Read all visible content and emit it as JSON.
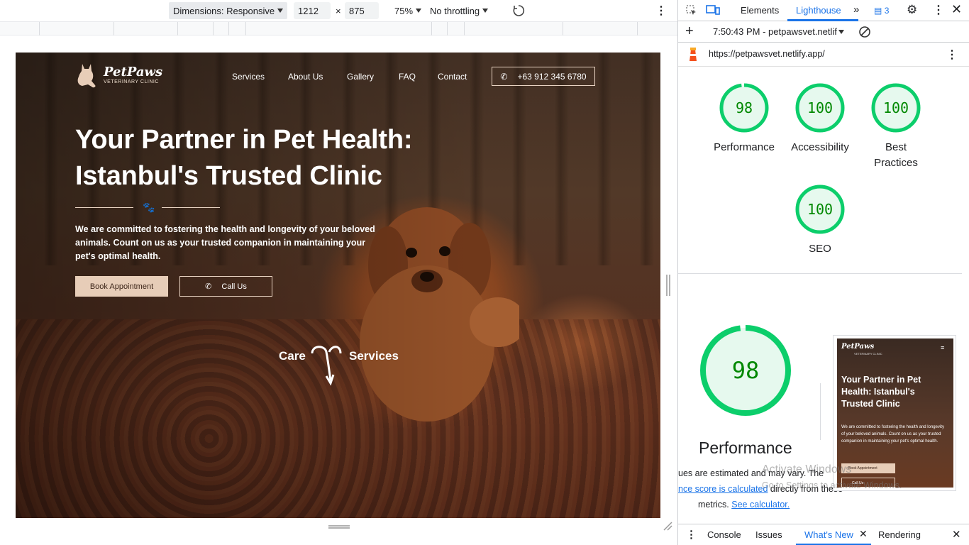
{
  "device_toolbar": {
    "dimensions_label": "Dimensions: Responsive",
    "width": "1212",
    "times": "×",
    "height": "875",
    "zoom": "75%",
    "throttling": "No throttling"
  },
  "site": {
    "logo_name": "PetPaws",
    "logo_sub": "VETERINARY CLINIC",
    "nav": [
      "Services",
      "About Us",
      "Gallery",
      "FAQ",
      "Contact"
    ],
    "phone": "+63 912 345 6780",
    "headline": "Your Partner in Pet Health: Istanbul's Trusted Clinic",
    "lead": "We are committed to fostering the health and longevity of your beloved animals. Count on us as your trusted companion in maintaining your pet's optimal health.",
    "book_btn": "Book Appointment",
    "call_btn": "Call Us",
    "care_label": "Care",
    "services_label": "Services"
  },
  "devtools": {
    "tabs": [
      "Elements",
      "Lighthouse"
    ],
    "active_tab": "Lighthouse",
    "issues_count": "3",
    "report_time": "7:50:43 PM - petpawsvet.netlif",
    "url": "https://petpawsvet.netlify.app/",
    "scores": [
      {
        "label": "Performance",
        "value": "98"
      },
      {
        "label": "Accessibility",
        "value": "100"
      },
      {
        "label": "Best Practices",
        "value": "100"
      },
      {
        "label": "SEO",
        "value": "100"
      }
    ],
    "big_score": "98",
    "big_label": "Performance",
    "note_line1": "ues are estimated and may vary. The",
    "note_link1": "nce score is calculated",
    "note_rest": " directly from these",
    "note_line3": "metrics. ",
    "note_link2": "See calculator.",
    "thumb": {
      "logo": "PetPaws",
      "logo_sub": "VETERINARY CLINIC",
      "headline": "Your Partner in Pet Health: Istanbul's Trusted Clinic",
      "lead": "We are committed to fostering the health and longevity of your beloved animals. Count on us as your trusted companion in maintaining your pet's optimal health.",
      "book": "Book Appointment",
      "call": "Call Us"
    },
    "bottom_tabs": [
      "Console",
      "Issues",
      "What's New",
      "Rendering"
    ],
    "active_bottom": "What's New",
    "watermark1": "Activate Windows",
    "watermark2": "Go to Settings to activate Windows."
  },
  "colors": {
    "accent": "#e7cdb8",
    "lighthouse_green": "#0cce6b",
    "link": "#1a73e8"
  }
}
